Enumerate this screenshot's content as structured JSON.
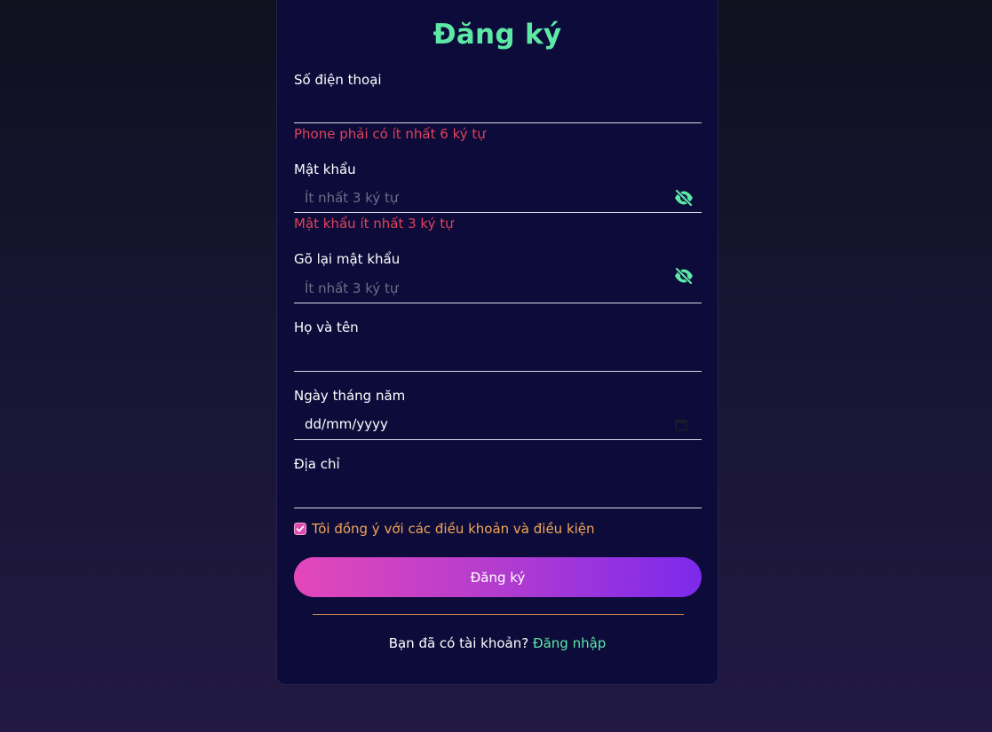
{
  "form": {
    "title": "Đăng ký",
    "phone": {
      "label": "Số điện thoại",
      "value": "",
      "error": "Phone phải có ít nhất 6 ký tự"
    },
    "password": {
      "label": "Mật khẩu",
      "placeholder": "Ít nhất 3 ký tự",
      "error": "Mật khẩu ít nhất 3 ký tự",
      "toggle_icon": "eye-off-icon"
    },
    "confirm_password": {
      "label": "Gõ lại mật khẩu",
      "placeholder": "Ít nhất 3 ký tự",
      "toggle_icon": "eye-off-icon"
    },
    "full_name": {
      "label": "Họ và tên",
      "value": ""
    },
    "birthday": {
      "label": "Ngày tháng năm",
      "value": "dd/mm/yyyy",
      "icon": "calendar-icon"
    },
    "address": {
      "label": "Địa chỉ",
      "value": ""
    },
    "agree": {
      "checked": true,
      "label": "Tôi đồng ý với các điều khoản và điều kiện"
    },
    "submit_label": "Đăng ký",
    "login_prompt": "Bạn đã có tài khoản?",
    "login_link": "Đăng nhập"
  },
  "colors": {
    "accent_green": "#5ee8a6",
    "error_red": "#e0435a",
    "agree_orange": "#f2a653",
    "card_bg": "#0c0b3a",
    "button_gradient_start": "#e447b9",
    "button_gradient_end": "#7c29ec"
  }
}
